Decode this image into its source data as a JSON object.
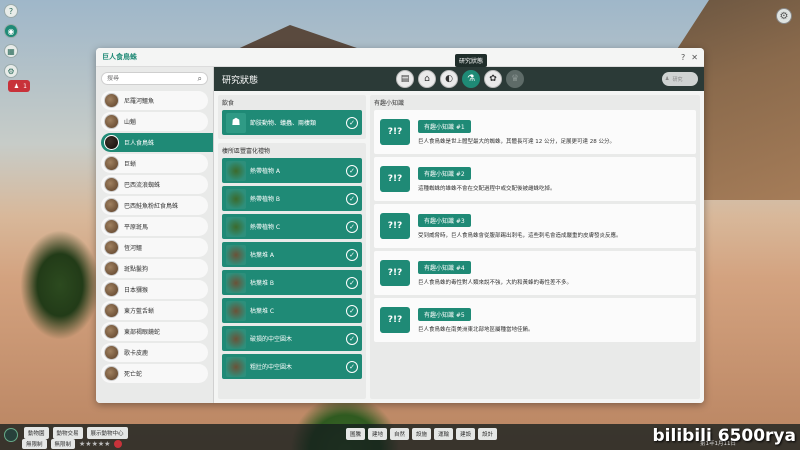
{
  "window": {
    "title": "巨人食鳥蛛",
    "help_label": "?",
    "close_label": "✕"
  },
  "tooltip": "研究狀態",
  "search": {
    "placeholder": "搜尋",
    "value": ""
  },
  "species": [
    {
      "name": "尼羅河鱷魚",
      "active": false
    },
    {
      "name": "山魈",
      "active": false
    },
    {
      "name": "巨人食鳥蛛",
      "active": true
    },
    {
      "name": "巨蜥",
      "active": false
    },
    {
      "name": "巴西流浪蜘蛛",
      "active": false
    },
    {
      "name": "巴西鮭魚粉紅食鳥蛛",
      "active": false
    },
    {
      "name": "平原斑馬",
      "active": false
    },
    {
      "name": "恆河鱷",
      "active": false
    },
    {
      "name": "斑點鬣狗",
      "active": false
    },
    {
      "name": "日本獼猴",
      "active": false
    },
    {
      "name": "東方藍舌蜥",
      "active": false
    },
    {
      "name": "東部褐眼鏡蛇",
      "active": false
    },
    {
      "name": "歌卡皮鹿",
      "active": false
    },
    {
      "name": "死亡蛇",
      "active": false
    }
  ],
  "content": {
    "title": "研究狀態",
    "pill_label": "研究"
  },
  "tabs": [
    {
      "name": "document-tab",
      "glyph": "▤",
      "state": "normal"
    },
    {
      "name": "habitat-tab",
      "glyph": "⌂",
      "state": "normal"
    },
    {
      "name": "food-tab",
      "glyph": "◐",
      "state": "normal"
    },
    {
      "name": "research-tab",
      "glyph": "⚗",
      "state": "active"
    },
    {
      "name": "paw-tab",
      "glyph": "✿",
      "state": "normal"
    },
    {
      "name": "trophy-tab",
      "glyph": "♛",
      "state": "disabled"
    }
  ],
  "diet": {
    "label": "飲食",
    "items": [
      {
        "label": "節肢動物、蟻蟲、兩棲類",
        "checked": true
      }
    ]
  },
  "enrichment": {
    "label": "棲所區豐富化禮物",
    "items": [
      {
        "label": "熱帶植物 A",
        "kind": "plant"
      },
      {
        "label": "熱帶植物 B",
        "kind": "plant"
      },
      {
        "label": "熱帶植物 C",
        "kind": "plant"
      },
      {
        "label": "枯葉堆 A",
        "kind": "log"
      },
      {
        "label": "枯葉堆 B",
        "kind": "log"
      },
      {
        "label": "枯葉堆 C",
        "kind": "log"
      },
      {
        "label": "破損的中空圓木",
        "kind": "log"
      },
      {
        "label": "粗壯的中空圓木",
        "kind": "log"
      }
    ]
  },
  "facts": {
    "label": "有趣小知識",
    "items": [
      {
        "tag": "有趣小知識 #1",
        "text": "巨人食鳥蛛是世上體型最大的蜘蛛，其體長可達 12 公分，足展更可達 28 公分。"
      },
      {
        "tag": "有趣小知識 #2",
        "text": "這種蜘蛛的雄蛛不會在交配過程中或交配後被雌蛛吃掉。"
      },
      {
        "tag": "有趣小知識 #3",
        "text": "受到威脅時，巨人食鳥蛛會從腹部踢出刺毛，這些刺毛會造成嚴重的皮膚發炎反應。"
      },
      {
        "tag": "有趣小知識 #4",
        "text": "巨人食鳥蛛的毒性對人類來說不強，大約和黃蜂的毒性差不多。"
      },
      {
        "tag": "有趣小知識 #5",
        "text": "巨人食鳥蛛在南美洲東北部地區屬種當地佳餚。"
      }
    ],
    "icon_text": "?!?"
  },
  "bottom": {
    "tabs": [
      "動物園",
      "動物交易",
      "展示動物中心"
    ],
    "row2": [
      "無限制",
      "無限制"
    ],
    "stars": "★★★★★",
    "modes": [
      "圖騰",
      "建地",
      "自然",
      "設施",
      "運輸",
      "建設",
      "設計"
    ],
    "date": "第1年1月11日",
    "watermark": "bilibili 6500rya"
  },
  "hud": {
    "badge_count": "1"
  },
  "colors": {
    "accent": "#1f8a76",
    "header_bg": "#2b3a37",
    "window_bg": "#f4f5f4"
  }
}
